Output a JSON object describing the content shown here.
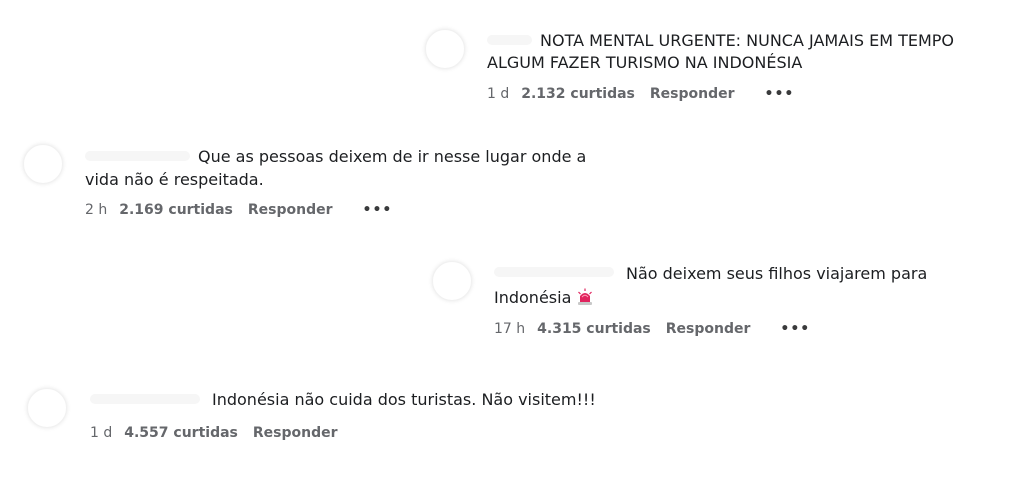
{
  "comments": [
    {
      "text_line1": "NOTA MENTAL URGENTE: NUNCA JAMAIS EM TEMPO",
      "text_line2": "ALGUM FAZER TURISMO NA INDONÉSIA",
      "time": "1 d",
      "likes": "2.132 curtidas",
      "reply": "Responder",
      "more": "•••"
    },
    {
      "text_line1": "Que as pessoas deixem de ir nesse lugar onde a",
      "text_line2": "vida não é respeitada.",
      "time": "2 h",
      "likes": "2.169 curtidas",
      "reply": "Responder",
      "more": "•••"
    },
    {
      "text_line1": "Não deixem seus filhos viajarem para",
      "text_line2": "Indonésia",
      "emoji_icon": "police-light-icon",
      "time": "17 h",
      "likes": "4.315 curtidas",
      "reply": "Responder",
      "more": "•••"
    },
    {
      "text_line1": "Indonésia não cuida dos turistas. Não visitem!!!",
      "time": "1 d",
      "likes": "4.557 curtidas",
      "reply": "Responder"
    }
  ],
  "colors": {
    "text": "#1c1e21",
    "meta": "#65676b",
    "alarm_red": "#e0245e"
  }
}
